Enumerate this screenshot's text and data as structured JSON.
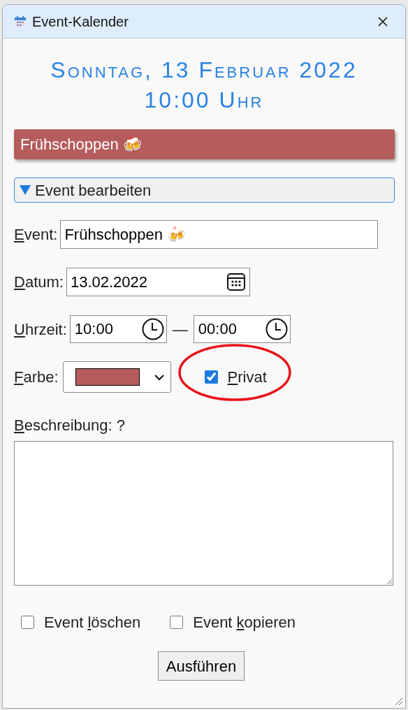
{
  "window": {
    "title": "Event-Kalender"
  },
  "heading": {
    "date": "Sonntag, 13 Februar 2022",
    "time": "10:00 Uhr"
  },
  "event_banner": {
    "title": "Frühschoppen 🍻",
    "color": "#b55c5c"
  },
  "details": {
    "summary": "Event bearbeiten",
    "expanded": true
  },
  "form": {
    "event": {
      "label": {
        "key": "E",
        "after": "vent:"
      },
      "value": "Frühschoppen 🍻"
    },
    "date": {
      "label": {
        "key": "D",
        "after": "atum:"
      },
      "value": "13.02.2022"
    },
    "time": {
      "label": {
        "key": "U",
        "after": "hrzeit:"
      },
      "start": "10:00",
      "separator": "—",
      "end": "00:00"
    },
    "color_field": {
      "label": {
        "key": "F",
        "after": "arbe:"
      },
      "color": "#b55c5c"
    },
    "private": {
      "label": {
        "key": "P",
        "after": "rivat"
      },
      "checked": true,
      "highlighted": true
    },
    "description": {
      "label": {
        "key": "B",
        "after": "eschreibung: ?"
      }
    },
    "options": [
      {
        "label": {
          "before": "Event ",
          "key": "l",
          "after": "öschen"
        },
        "checked": false
      },
      {
        "label": {
          "before": "Event ",
          "key": "k",
          "after": "opieren"
        },
        "checked": false
      }
    ],
    "submit": "Ausführen"
  }
}
